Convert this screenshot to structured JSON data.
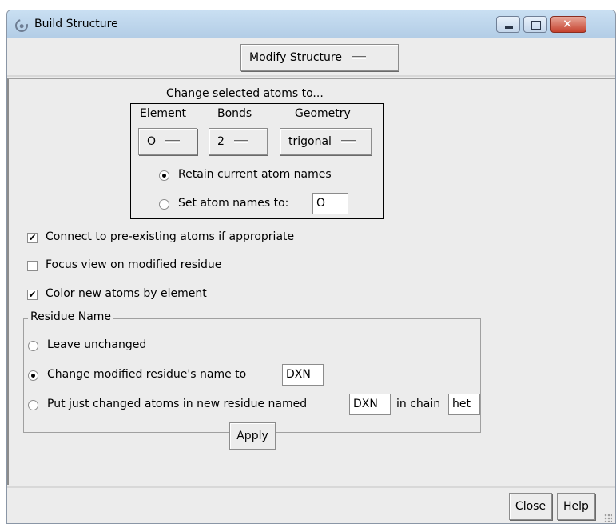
{
  "window": {
    "title": "Build Structure"
  },
  "mode": {
    "label": "Modify Structure"
  },
  "change": {
    "heading": "Change selected atoms to...",
    "element": {
      "label": "Element",
      "value": "O"
    },
    "bonds": {
      "label": "Bonds",
      "value": "2"
    },
    "geometry": {
      "label": "Geometry",
      "value": "trigonal"
    },
    "retain_label": "Retain current atom names",
    "setnames_label": "Set atom names to:",
    "setnames_value": "O",
    "retain_selected": true
  },
  "options": {
    "connect": {
      "label": "Connect to pre-existing atoms if appropriate",
      "checked": true
    },
    "focus": {
      "label": "Focus view on modified residue",
      "checked": false
    },
    "color": {
      "label": "Color new atoms by element",
      "checked": true
    }
  },
  "residue": {
    "legend": "Residue Name",
    "leave_label": "Leave unchanged",
    "change_label": "Change modified residue's name to",
    "change_value": "DXN",
    "new_label": "Put just changed atoms in new residue named",
    "new_value": "DXN",
    "chain_label": "in chain",
    "chain_value": "het",
    "selected": "change"
  },
  "buttons": {
    "apply": "Apply",
    "close": "Close",
    "help": "Help"
  },
  "checkmark": "✔"
}
